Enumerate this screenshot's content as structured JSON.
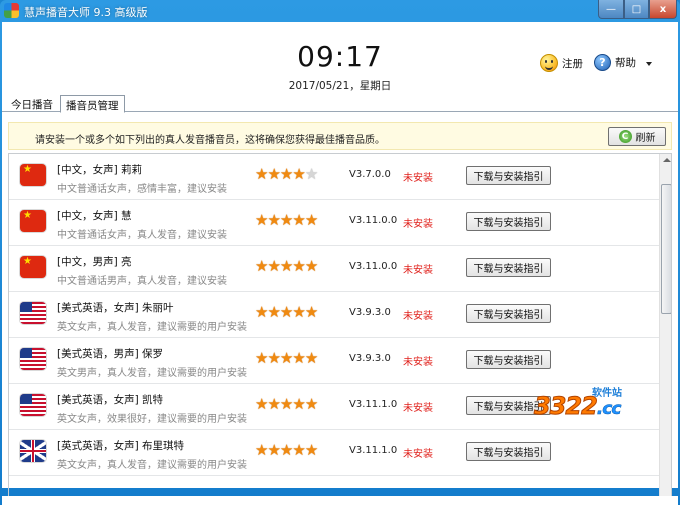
{
  "window": {
    "title": "慧声播音大师 9.3 高级版",
    "controls": {
      "minimize": "—",
      "maximize": "□",
      "close": "x"
    }
  },
  "header": {
    "time": "09:17",
    "date": "2017/05/21，星期日",
    "register_label": "注册",
    "help_label": "帮助",
    "help_glyph": "?"
  },
  "tabs": [
    {
      "label": "今日播音",
      "active": false
    },
    {
      "label": "播音员管理",
      "active": true
    }
  ],
  "notice": {
    "text": "请安装一个或多个如下列出的真人发音播音员，这将确保您获得最佳播音品质。",
    "refresh_label": "刷新",
    "refresh_glyph": "C"
  },
  "voices": [
    {
      "flag": "cn",
      "name": "[中文，女声] 莉莉",
      "desc": "中文普通话女声，感情丰富，建议安装",
      "rating": 4,
      "version": "V3.7.0.0",
      "status": "未安装",
      "button": "下载与安装指引"
    },
    {
      "flag": "cn",
      "name": "[中文，女声] 慧",
      "desc": "中文普通话女声，真人发音，建议安装",
      "rating": 5,
      "version": "V3.11.0.0",
      "status": "未安装",
      "button": "下载与安装指引"
    },
    {
      "flag": "cn",
      "name": "[中文，男声] 亮",
      "desc": "中文普通话男声，真人发音，建议安装",
      "rating": 5,
      "version": "V3.11.0.0",
      "status": "未安装",
      "button": "下载与安装指引"
    },
    {
      "flag": "us",
      "name": "[美式英语，女声] 朱丽叶",
      "desc": "英文女声，真人发音，建议需要的用户安装",
      "rating": 5,
      "version": "V3.9.3.0",
      "status": "未安装",
      "button": "下载与安装指引"
    },
    {
      "flag": "us",
      "name": "[美式英语，男声] 保罗",
      "desc": "英文男声，真人发音，建议需要的用户安装",
      "rating": 5,
      "version": "V3.9.3.0",
      "status": "未安装",
      "button": "下载与安装指引"
    },
    {
      "flag": "us",
      "name": "[美式英语，女声] 凯特",
      "desc": "英文女声，效果很好，建议需要的用户安装",
      "rating": 5,
      "version": "V3.11.1.0",
      "status": "未安装",
      "button": "下载与安装指引"
    },
    {
      "flag": "gb",
      "name": "[英式英语，女声] 布里琪特",
      "desc": "英文女声，真人发音，建议需要的用户安装",
      "rating": 5,
      "version": "V3.11.1.0",
      "status": "未安装",
      "button": "下载与安装指引"
    }
  ],
  "watermark": {
    "main": "3322",
    "suffix": ".cc",
    "small": "软件站"
  },
  "colors": {
    "accent": "#1b86d2",
    "status_red": "#e0201b",
    "star": "#f08a11",
    "notice_bg": "#fffbe2"
  }
}
